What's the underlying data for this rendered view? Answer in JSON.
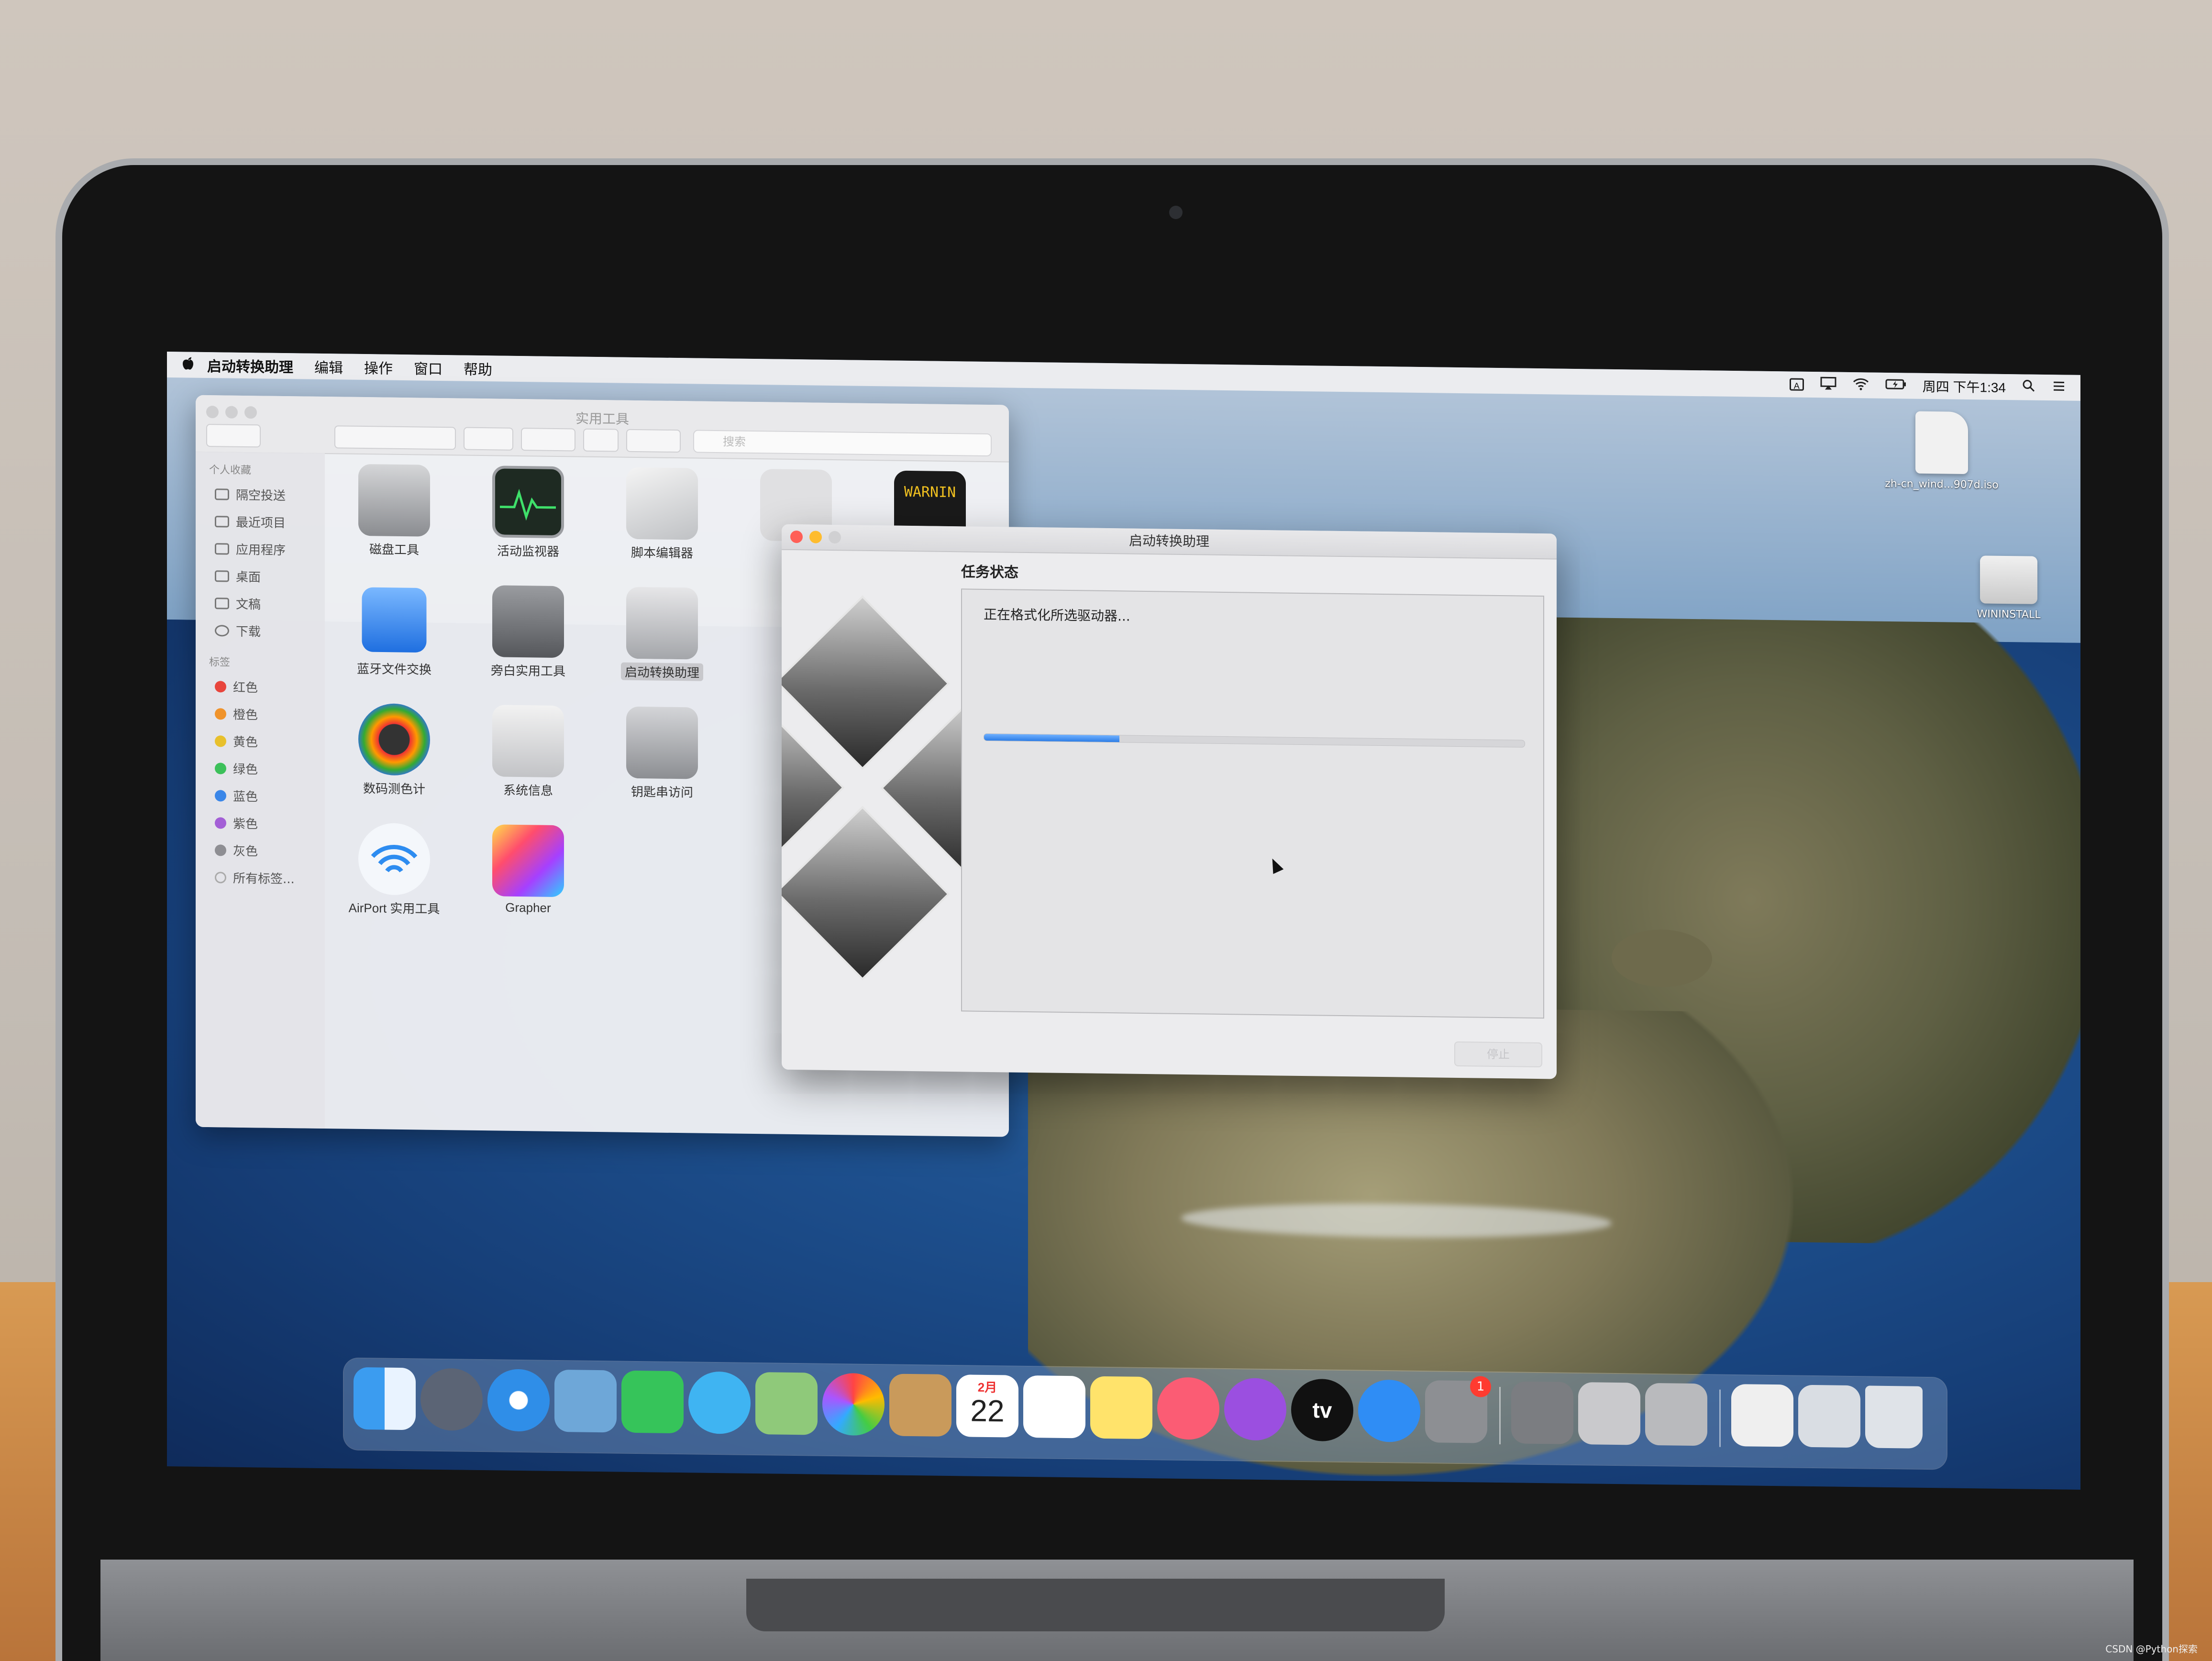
{
  "menubar": {
    "apple": "",
    "app_name": "启动转换助理",
    "menus": [
      "编辑",
      "操作",
      "窗口",
      "帮助"
    ],
    "input_indicator": "A",
    "clock": "周四 下午1:34"
  },
  "finder": {
    "title": "实用工具",
    "search_placeholder": "搜索",
    "sidebar": {
      "favorites_header": "个人收藏",
      "favorites": [
        "隔空投送",
        "最近项目",
        "应用程序",
        "桌面",
        "文稿",
        "下载"
      ],
      "tags_header": "标签",
      "tags": [
        {
          "label": "红色",
          "color": "#e8453c"
        },
        {
          "label": "橙色",
          "color": "#f0932b"
        },
        {
          "label": "黄色",
          "color": "#e8c02c"
        },
        {
          "label": "绿色",
          "color": "#3cc05a"
        },
        {
          "label": "蓝色",
          "color": "#3a86e8"
        },
        {
          "label": "紫色",
          "color": "#a35fd6"
        },
        {
          "label": "灰色",
          "color": "#8e8e93"
        }
      ],
      "all_tags": "所有标签..."
    },
    "apps": [
      {
        "label": "磁盘工具",
        "icon": "disk-utility-icon"
      },
      {
        "label": "活动监视器",
        "icon": "activity-monitor-icon"
      },
      {
        "label": "脚本编辑器",
        "icon": "script-editor-icon"
      },
      {
        "label": "",
        "icon": "screenshot-icon"
      },
      {
        "label": "",
        "icon": "console-icon",
        "text": "WARNIN"
      },
      {
        "label": "蓝牙文件交换",
        "icon": "bluetooth-icon"
      },
      {
        "label": "旁白实用工具",
        "icon": "voiceover-icon"
      },
      {
        "label": "启动转换助理",
        "icon": "boot-camp-icon",
        "selected": true
      },
      {
        "label": "数码测色计",
        "icon": "color-meter-icon"
      },
      {
        "label": "系统信息",
        "icon": "system-info-icon"
      },
      {
        "label": "钥匙串访问",
        "icon": "keychain-icon"
      },
      {
        "label": "AirPort 实用工具",
        "icon": "airport-icon"
      },
      {
        "label": "Grapher",
        "icon": "grapher-icon"
      }
    ]
  },
  "bootcamp": {
    "title": "启动转换助理",
    "section": "任务状态",
    "status": "正在格式化所选驱动器...",
    "progress": 0.25,
    "stop_label": "停止"
  },
  "desktop": {
    "items": [
      {
        "label": "zh-cn_wind...907d.iso",
        "icon": "iso-file-icon"
      },
      {
        "label": "WININSTALL",
        "icon": "usb-drive-icon"
      }
    ]
  },
  "dock": {
    "apps": [
      {
        "name": "Finder",
        "icon": "finder-icon",
        "color": "#3b9cf0"
      },
      {
        "name": "Launchpad",
        "icon": "launchpad-icon",
        "color": "#5b6475"
      },
      {
        "name": "Safari",
        "icon": "safari-icon",
        "color": "#2f8ee8"
      },
      {
        "name": "Mail",
        "icon": "mail-icon",
        "color": "#6ea7d8"
      },
      {
        "name": "FaceTime",
        "icon": "facetime-icon",
        "color": "#36c45a"
      },
      {
        "name": "Messages",
        "icon": "messages-icon",
        "color": "#3fb4f2"
      },
      {
        "name": "Maps",
        "icon": "maps-icon",
        "color": "#8fc97a"
      },
      {
        "name": "Photos",
        "icon": "photos-icon",
        "color": "#f2f2f2"
      },
      {
        "name": "Contacts",
        "icon": "contacts-icon",
        "color": "#c99a5b"
      },
      {
        "name": "Calendar",
        "icon": "calendar-icon",
        "color": "#ffffff",
        "month": "2月",
        "day": "22"
      },
      {
        "name": "Reminders",
        "icon": "reminders-icon",
        "color": "#ffffff"
      },
      {
        "name": "Notes",
        "icon": "notes-icon",
        "color": "#ffe36b"
      },
      {
        "name": "Music",
        "icon": "music-icon",
        "color": "#fb5c74"
      },
      {
        "name": "Podcasts",
        "icon": "podcasts-icon",
        "color": "#9b4fe0"
      },
      {
        "name": "TV",
        "icon": "apple-tv-icon",
        "color": "#111111",
        "text": "tv"
      },
      {
        "name": "App Store",
        "icon": "app-store-icon",
        "color": "#2f8df5"
      },
      {
        "name": "System Preferences",
        "icon": "system-preferences-icon",
        "color": "#8d8f93",
        "badge": "1"
      }
    ],
    "recent": [
      {
        "name": "VoiceOver Utility",
        "icon": "voiceover-icon",
        "color": "#7b7d81"
      },
      {
        "name": "Boot Camp Assistant",
        "icon": "boot-camp-icon",
        "color": "#c9c9cc"
      },
      {
        "name": "Disk Utility",
        "icon": "disk-utility-icon",
        "color": "#b9babd"
      }
    ],
    "tail": [
      {
        "name": "Document",
        "icon": "document-icon",
        "color": "#efefef"
      },
      {
        "name": "Downloads",
        "icon": "downloads-icon",
        "color": "#d9dde3"
      },
      {
        "name": "Trash",
        "icon": "trash-icon",
        "color": "#dfe3e8"
      }
    ]
  },
  "watermark": "CSDN @Python探索"
}
